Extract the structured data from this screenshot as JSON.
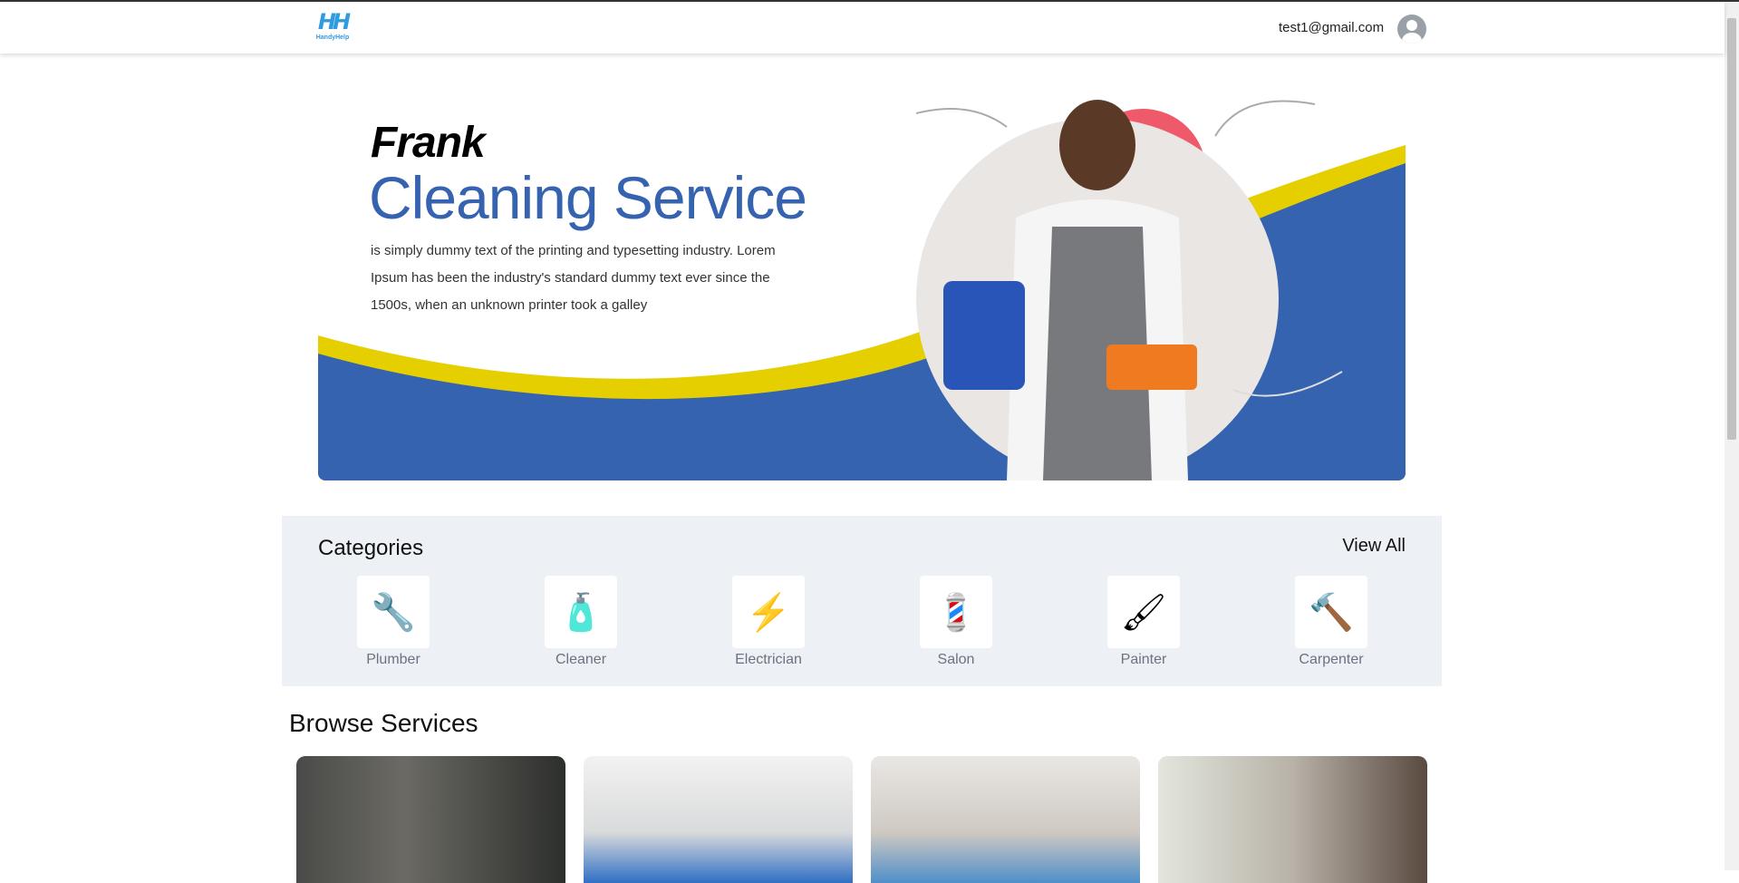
{
  "header": {
    "logo_text": "HandyHelp",
    "user_email": "test1@gmail.com"
  },
  "banner": {
    "name": "Frank",
    "title": "Cleaning Service",
    "description": "is simply dummy text of the printing and typesetting industry. Lorem Ipsum has been the industry's standard dummy text ever since the 1500s, when an unknown printer took a galley",
    "colors": {
      "blue": "#3563b0",
      "yellow": "#e5cf00"
    }
  },
  "categories": {
    "title": "Categories",
    "view_all": "View All",
    "items": [
      {
        "label": "Plumber",
        "icon": "plumber-icon"
      },
      {
        "label": "Cleaner",
        "icon": "cleaner-icon"
      },
      {
        "label": "Electrician",
        "icon": "electrician-icon"
      },
      {
        "label": "Salon",
        "icon": "salon-icon"
      },
      {
        "label": "Painter",
        "icon": "painter-icon"
      },
      {
        "label": "Carpenter",
        "icon": "carpenter-icon"
      }
    ]
  },
  "browse": {
    "title": "Browse Services"
  }
}
